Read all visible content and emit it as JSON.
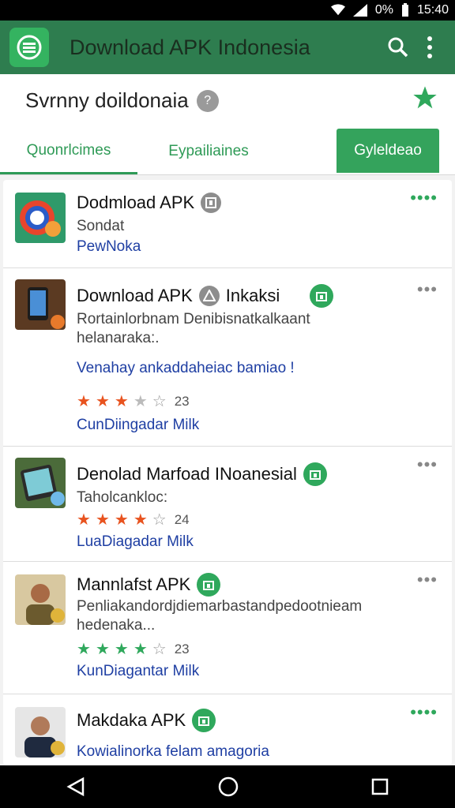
{
  "status": {
    "battery": "0%",
    "time": "15:40"
  },
  "appbar": {
    "title": "Download APK Indonesia",
    "logo_icon": "list-icon",
    "search_icon": "search-icon",
    "menu_icon": "more-vert-icon"
  },
  "header": {
    "title": "Svrnny doildonaia",
    "help_icon": "help-icon",
    "fav_icon": "star-icon"
  },
  "tabs": [
    {
      "label": "Quonrlcimes"
    },
    {
      "label": "Eypailiaines"
    },
    {
      "label": "Gyleldeao"
    }
  ],
  "items": [
    {
      "name": "Dodmload APK",
      "line1": "Sondat",
      "link": "PewNoka"
    },
    {
      "name": "Download APK",
      "name_suffix": "Inkaksi",
      "line1": "Rortainlorbnam Denibisnatkalkaant",
      "line2": "helanaraka:.",
      "link": "Venahay ankaddaheiac bamiao !",
      "rating": 3,
      "count": "23",
      "link2": "CunDiingadar Milk"
    },
    {
      "name": "Denolad Marfoad INoanesial",
      "line1": "Taholcankloc:",
      "rating": 4,
      "count": "24",
      "link2": "LuaDiagadar Milk"
    },
    {
      "name": "Mannlafst APK",
      "line1": "Penliakandordjdiemarbastandpedootnieam",
      "line2": "hedenaka...",
      "rating": 4,
      "count": "23",
      "link2": "KunDiagantar Milk"
    },
    {
      "name": "Makdaka APK",
      "link": "Kowialinorka felam amagoria"
    }
  ],
  "colors": {
    "accent": "#2e9a56",
    "appbar": "#2e7d4f",
    "star_orange": "#e8531f",
    "star_green": "#2fa85c",
    "link": "#1f3fa3"
  }
}
